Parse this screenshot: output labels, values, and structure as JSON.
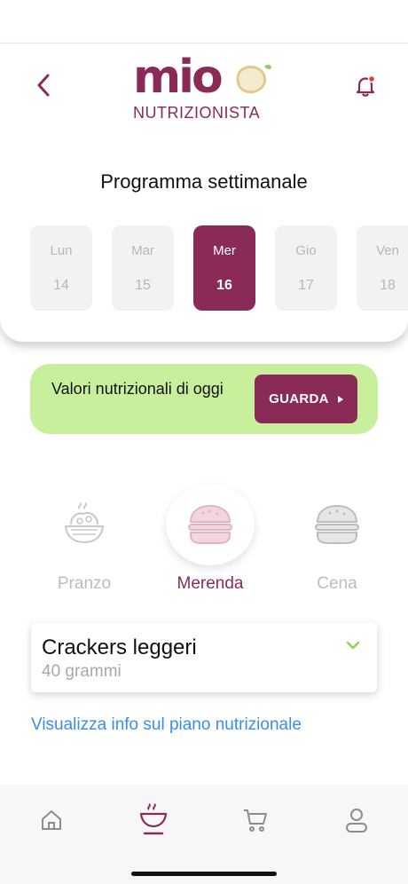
{
  "header": {
    "logo_word": "mio",
    "logo_subtitle": "NUTRIZIONISTA",
    "back_icon": "chevron-left-icon",
    "bell_icon": "bell-icon",
    "notification_dot": true
  },
  "week": {
    "title": "Programma settimanale",
    "days": [
      {
        "name": "Lun",
        "num": "14"
      },
      {
        "name": "Mar",
        "num": "15"
      },
      {
        "name": "Mer",
        "num": "16",
        "selected": true
      },
      {
        "name": "Gio",
        "num": "17"
      },
      {
        "name": "Ven",
        "num": "18"
      }
    ]
  },
  "nutrition_banner": {
    "text": "Valori nutrizionali di oggi",
    "button_label": "GUARDA"
  },
  "meals": [
    {
      "label": "Pranzo",
      "icon": "pasta-bowl-icon"
    },
    {
      "label": "Merenda",
      "icon": "burger-icon",
      "selected": true
    },
    {
      "label": "Cena",
      "icon": "burger-icon"
    }
  ],
  "food": {
    "name": "Crackers leggeri",
    "quantity": "40 grammi"
  },
  "info_link": "Visualizza info sul piano nutrizionale",
  "bottom_nav": [
    {
      "icon": "home-icon"
    },
    {
      "icon": "bowl-icon",
      "active": true
    },
    {
      "icon": "cart-icon"
    },
    {
      "icon": "profile-icon"
    }
  ],
  "colors": {
    "brand": "#8a2a57",
    "banner": "#c8f09c",
    "link": "#3a8ee6",
    "chevron": "#8fcf5a"
  }
}
